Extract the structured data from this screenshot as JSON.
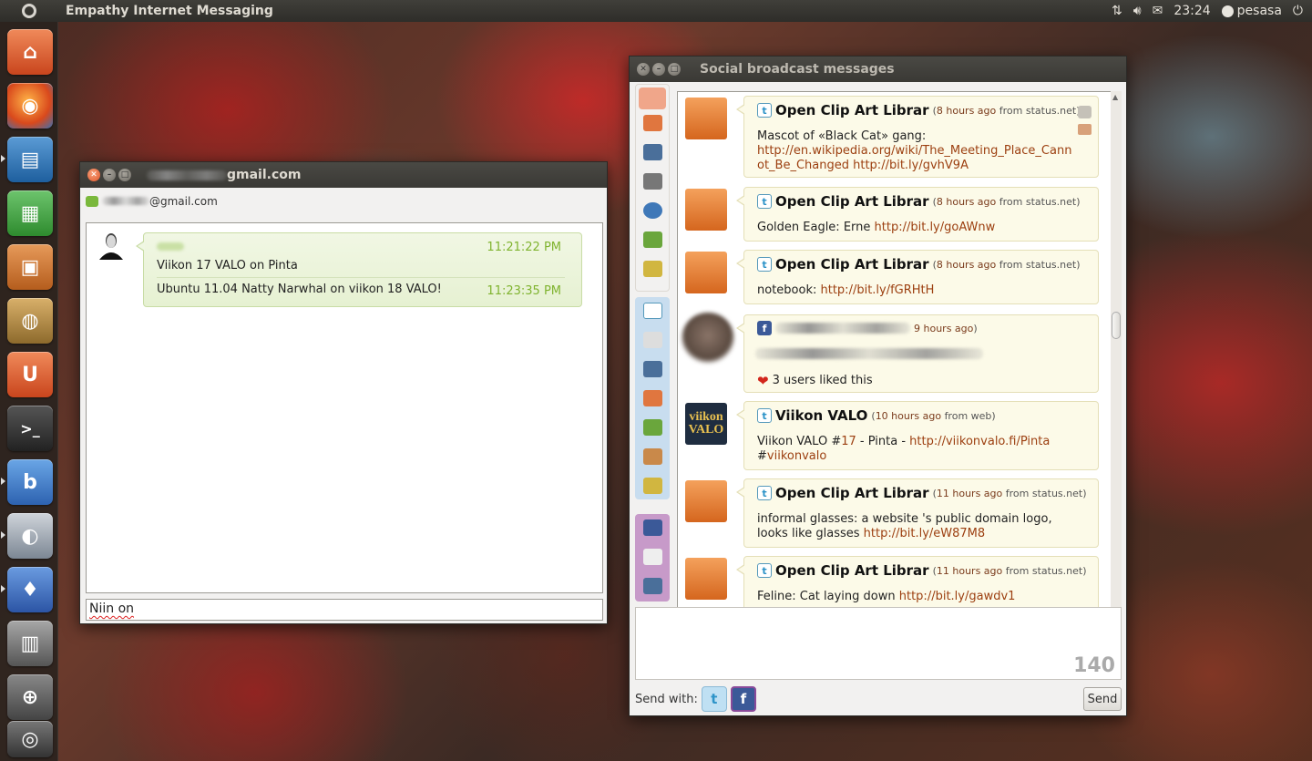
{
  "top_panel": {
    "app_title": "Empathy Internet Messaging",
    "clock": "23:24",
    "user": "pesasa"
  },
  "chat_window": {
    "title_suffix": "gmail.com",
    "contact_suffix": "@gmail.com",
    "messages": [
      {
        "text": "Viikon 17 VALO on Pinta",
        "time": "11:21:22 PM"
      },
      {
        "text": "Ubuntu 11.04 Natty Narwhal on viikon 18 VALO!",
        "time": "11:23:35 PM"
      }
    ],
    "input_value": "Niin on"
  },
  "social_window": {
    "title": "Social broadcast messages",
    "posts": [
      {
        "service": "twitter",
        "author": "Open Clip Art Librar",
        "time": "8 hours ago",
        "from_label": "from",
        "source": "status.net",
        "text": "Mascot of «Black Cat» gang:",
        "link": "http://en.wikipedia.org/wiki/The_Meeting_Place_Cannot_Be_Changed http://bit.ly/gvhV9A"
      },
      {
        "service": "twitter",
        "author": "Open Clip Art Librar",
        "time": "8 hours ago",
        "from_label": "from",
        "source": "status.net",
        "text": "Golden Eagle: Erne",
        "link": "http://bit.ly/goAWnw"
      },
      {
        "service": "twitter",
        "author": "Open Clip Art Librar",
        "time": "8 hours ago",
        "from_label": "from",
        "source": "status.net",
        "text": "notebook:",
        "link": "http://bit.ly/fGRHtH"
      },
      {
        "service": "facebook",
        "time_partial": "9 hours ago",
        "likes": "3 users liked this"
      },
      {
        "service": "twitter",
        "author": "Viikon VALO",
        "time": "10 hours ago",
        "from_label": "from",
        "source": "web",
        "text_parts": [
          "Viikon VALO #",
          "17",
          " - Pinta - ",
          "http://viikonvalo.fi/Pinta",
          "#",
          "viikonvalo"
        ]
      },
      {
        "service": "twitter",
        "author": "Open Clip Art Librar",
        "time": "11 hours ago",
        "from_label": "from",
        "source": "status.net",
        "text": "informal glasses: a website 's public domain logo, looks like glasses",
        "link": "http://bit.ly/eW87M8"
      },
      {
        "service": "twitter",
        "author": "Open Clip Art Librar",
        "time": "11 hours ago",
        "from_label": "from",
        "source": "status.net",
        "text": "Feline: Cat laying down",
        "link": "http://bit.ly/gawdv1"
      }
    ],
    "avatar_text_valo": "viikon VALO",
    "char_count": "140",
    "send_with_label": "Send with:",
    "send_button": "Send"
  },
  "colors": {
    "accent_orange": "#e0572a",
    "bubble_green": "#e6f1d2",
    "time_green": "#7fb32e",
    "post_bubble": "#fcfae8",
    "link_brown": "#9c3f10",
    "twitter_blue": "#2c93c8",
    "facebook_blue": "#3b5998"
  }
}
